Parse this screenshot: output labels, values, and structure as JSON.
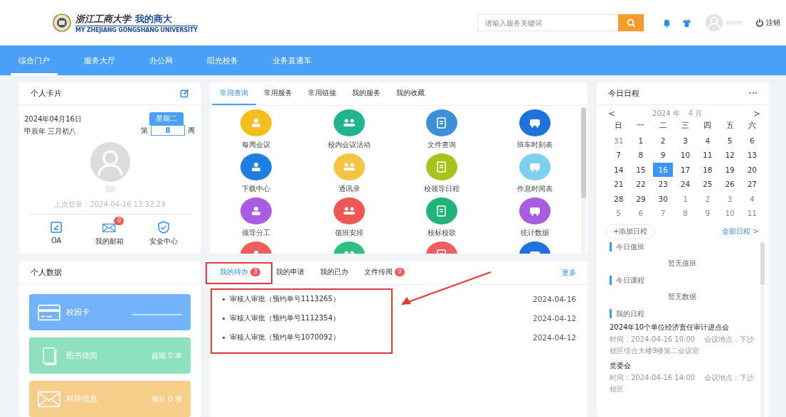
{
  "header": {
    "logo_title": "浙江工商大学",
    "logo_slogan": "我的商大",
    "logo_subtitle": "MY ZHEJIANG GONGSHANG UNIVERSITY",
    "search": {
      "placeholder": "请输入服务关键词"
    },
    "logout": "注销"
  },
  "nav": [
    {
      "label": "综合门户",
      "selected": true
    },
    {
      "label": "服务大厅",
      "selected": false
    },
    {
      "label": "办公网",
      "selected": false
    },
    {
      "label": "阳光校务",
      "selected": false
    },
    {
      "label": "业务直通车",
      "selected": false
    }
  ],
  "profile_card": {
    "title": "个人卡片",
    "date": "2024年04月16日",
    "lunar": "甲辰年 三月初八",
    "weekday": "星期二",
    "week_prefix": "第",
    "week": "8",
    "week_suffix": "周",
    "last_login": "上次登录：2024-04-16 13:32:29",
    "links": [
      {
        "label": "OA",
        "kind": "oa"
      },
      {
        "label": "我的邮箱",
        "kind": "mail",
        "badge": "0"
      },
      {
        "label": "安全中心",
        "kind": "shield"
      }
    ]
  },
  "personal_data": {
    "title": "个人数据",
    "tiles": [
      {
        "label": "校园卡",
        "kind": "card",
        "color": "#73b3fb"
      },
      {
        "label": "图书借阅",
        "value": "超期 0 本",
        "kind": "book",
        "color": "#8de0c0"
      },
      {
        "label": "科研信息",
        "value": "项目 0 项",
        "kind": "mail",
        "color": "#f7cd8a"
      }
    ]
  },
  "services": {
    "tabs": [
      {
        "label": "常用查询",
        "selected": true
      },
      {
        "label": "常用服务",
        "selected": false
      },
      {
        "label": "常用链接",
        "selected": false
      },
      {
        "label": "我的服务",
        "selected": false
      },
      {
        "label": "我的收藏",
        "selected": false
      }
    ],
    "items": [
      {
        "label": "每周会议",
        "color": "#f2bf1c"
      },
      {
        "label": "校内会议活动",
        "color": "#21b58f"
      },
      {
        "label": "文件查询",
        "color": "#3d8fd8"
      },
      {
        "label": "班车时刻表",
        "color": "#1e73dc"
      },
      {
        "label": "下载中心",
        "color": "#1e7fe0"
      },
      {
        "label": "通讯录",
        "color": "#f7c344"
      },
      {
        "label": "校领导日程",
        "color": "#a7c41d"
      },
      {
        "label": "作息时间表",
        "color": "#7fcff2"
      },
      {
        "label": "领导分工",
        "color": "#a95de0"
      },
      {
        "label": "值班安排",
        "color": "#ef5757"
      },
      {
        "label": "校标校歌",
        "color": "#22b27c"
      },
      {
        "label": "统计数据",
        "color": "#a95de0"
      },
      {
        "color": "#ef5e5e"
      },
      {
        "color": "#2fbf84"
      },
      {
        "color": "#ef5e5e"
      },
      {
        "color": "#1e73dc"
      }
    ]
  },
  "tasks": {
    "tabs": [
      {
        "label": "我的待办",
        "badge": "3",
        "selected": true
      },
      {
        "label": "我的申请",
        "selected": false
      },
      {
        "label": "我的已办",
        "selected": false
      },
      {
        "label": "文件传阅",
        "badge": "0",
        "selected": false
      }
    ],
    "more": "更多",
    "items": [
      {
        "title": "审核人审批（预约单号1113265）",
        "date": "2024-04-16"
      },
      {
        "title": "审核人审批（预约单号1112354）",
        "date": "2024-04-12"
      },
      {
        "title": "审核人审批（预约单号1070092）",
        "date": "2024-04-12"
      }
    ]
  },
  "schedule": {
    "title": "今日日程",
    "menu": "···",
    "prev": "<",
    "next": ">",
    "year": "2024 年",
    "month": "4 月",
    "weekdays": [
      "日",
      "一",
      "二",
      "三",
      "四",
      "五",
      "六"
    ],
    "weeks": [
      [
        {
          "day": "31",
          "other_month": true,
          "selected": false
        },
        {
          "day": "1",
          "other_month": false,
          "selected": false
        },
        {
          "day": "2",
          "other_month": false,
          "selected": false
        },
        {
          "day": "3",
          "other_month": false,
          "selected": false
        },
        {
          "day": "4",
          "other_month": false,
          "selected": false
        },
        {
          "day": "5",
          "other_month": false,
          "selected": false
        },
        {
          "day": "6",
          "other_month": false,
          "selected": false
        }
      ],
      [
        {
          "day": "7",
          "other_month": false,
          "selected": false
        },
        {
          "day": "8",
          "other_month": false,
          "selected": false
        },
        {
          "day": "9",
          "other_month": false,
          "selected": false
        },
        {
          "day": "10",
          "other_month": false,
          "selected": false
        },
        {
          "day": "11",
          "other_month": false,
          "selected": false
        },
        {
          "day": "12",
          "other_month": false,
          "selected": false
        },
        {
          "day": "13",
          "other_month": false,
          "selected": false
        }
      ],
      [
        {
          "day": "14",
          "other_month": false,
          "selected": false
        },
        {
          "day": "15",
          "other_month": false,
          "selected": false
        },
        {
          "day": "16",
          "other_month": false,
          "selected": true
        },
        {
          "day": "17",
          "other_month": false,
          "selected": false
        },
        {
          "day": "18",
          "other_month": false,
          "selected": false
        },
        {
          "day": "19",
          "other_month": false,
          "selected": false
        },
        {
          "day": "20",
          "other_month": false,
          "selected": false
        }
      ],
      [
        {
          "day": "21",
          "other_month": false,
          "selected": false
        },
        {
          "day": "22",
          "other_month": false,
          "selected": false
        },
        {
          "day": "23",
          "other_month": false,
          "selected": false
        },
        {
          "day": "24",
          "other_month": false,
          "selected": false
        },
        {
          "day": "25",
          "other_month": false,
          "selected": false
        },
        {
          "day": "26",
          "other_month": false,
          "selected": false
        },
        {
          "day": "27",
          "other_month": false,
          "selected": false
        }
      ],
      [
        {
          "day": "28",
          "other_month": false,
          "selected": false
        },
        {
          "day": "29",
          "other_month": false,
          "selected": false
        },
        {
          "day": "30",
          "other_month": false,
          "selected": false
        },
        {
          "day": "1",
          "other_month": true,
          "selected": false
        },
        {
          "day": "2",
          "other_month": true,
          "selected": false
        },
        {
          "day": "3",
          "other_month": true,
          "selected": false
        },
        {
          "day": "4",
          "other_month": true,
          "selected": false
        }
      ],
      [
        {
          "day": "5",
          "other_month": true,
          "selected": false
        },
        {
          "day": "6",
          "other_month": true,
          "selected": false
        },
        {
          "day": "7",
          "other_month": true,
          "selected": false
        },
        {
          "day": "8",
          "other_month": true,
          "selected": false
        },
        {
          "day": "9",
          "other_month": true,
          "selected": false
        },
        {
          "day": "10",
          "other_month": true,
          "selected": false
        },
        {
          "day": "11",
          "other_month": true,
          "selected": false
        }
      ]
    ],
    "add": "+添加日程",
    "all": "全部日程 >",
    "sections": [
      {
        "title": "今日值班",
        "empty": "暂无值班"
      },
      {
        "title": "今日课程",
        "empty": "暂无数据"
      },
      {
        "title": "我的日程",
        "events": [
          {
            "title": "2024年10个单位经济责任审计进点会",
            "meta": "时间：2024-04-16 10:00　 会议地点：下沙校区综合大楼9楼第二会议室"
          },
          {
            "title": "党委会",
            "meta": "时间：2024-04-16 14:00　 会议地点：下沙校区"
          }
        ]
      }
    ]
  }
}
